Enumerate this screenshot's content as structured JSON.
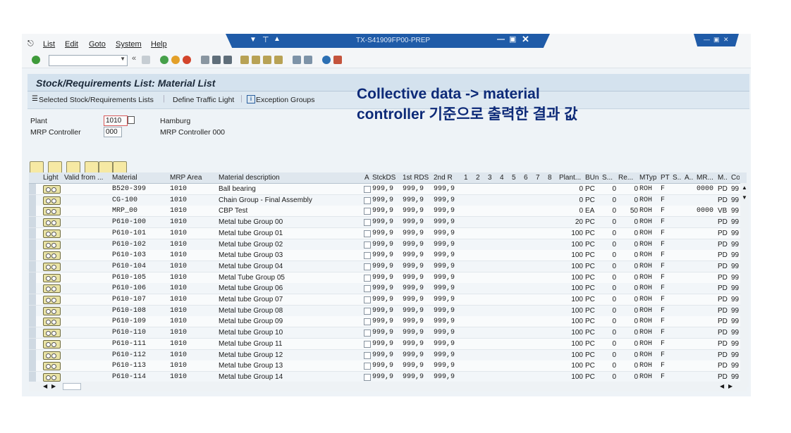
{
  "menu": [
    "List",
    "Edit",
    "Goto",
    "System",
    "Help"
  ],
  "window_title": "TX-S41909FP00-PREP",
  "page_title": "Stock/Requirements List: Material List",
  "app_toolbar": {
    "selected_lists": "Selected Stock/Requirements Lists",
    "define_traffic_light": "Define Traffic Light",
    "exception_groups": "Exception Groups"
  },
  "header": {
    "plant_label": "Plant",
    "plant_value": "1010",
    "plant_name": "Hamburg",
    "mrp_controller_label": "MRP Controller",
    "mrp_controller_value": "000",
    "mrp_controller_name": "MRP Controller 000"
  },
  "annotation": {
    "line1": "Collective data -> material",
    "line2": "controller 기준으로 출력한 결과 값"
  },
  "columns": [
    "Light",
    "Valid from ...",
    "Material",
    "MRP Area",
    "Material description",
    "A",
    "StckDS",
    "1st RDS",
    "2nd R",
    "1",
    "2",
    "3",
    "4",
    "5",
    "6",
    "7",
    "8",
    "Plant...",
    "BUn",
    "S...",
    "Re...",
    "MTyp",
    "PT",
    "S..",
    "A..",
    "MR...",
    "M..",
    "Co"
  ],
  "rows": [
    {
      "material": "B520-399",
      "area": "1010",
      "desc": "Ball bearing",
      "stckds": "999,9",
      "rds1": "999,9",
      "rds2": "999,9",
      "plant": "0",
      "bun": "PC",
      "s": "0",
      "re": "0",
      "mtyp": "ROH",
      "pt": "F",
      "mr": "0000",
      "m": "PD",
      "co": "99"
    },
    {
      "material": "CG-100",
      "area": "1010",
      "desc": "Chain Group - Final Assembly",
      "stckds": "999,9",
      "rds1": "999,9",
      "rds2": "999,9",
      "plant": "0",
      "bun": "PC",
      "s": "0",
      "re": "0",
      "mtyp": "ROH",
      "pt": "F",
      "mr": "",
      "m": "PD",
      "co": "99"
    },
    {
      "material": "MRP_00",
      "area": "1010",
      "desc": "CBP Test",
      "stckds": "999,9",
      "rds1": "999,9",
      "rds2": "999,9",
      "plant": "0",
      "bun": "EA",
      "s": "0",
      "re": "50",
      "mtyp": "ROH",
      "pt": "F",
      "mr": "0000",
      "m": "VB",
      "co": "99"
    },
    {
      "material": "P610-100",
      "area": "1010",
      "desc": "Metal tube Group 00",
      "stckds": "999,9",
      "rds1": "999,9",
      "rds2": "999,9",
      "plant": "20",
      "bun": "PC",
      "s": "0",
      "re": "0",
      "mtyp": "ROH",
      "pt": "F",
      "mr": "",
      "m": "PD",
      "co": "99"
    },
    {
      "material": "P610-101",
      "area": "1010",
      "desc": "Metal tube Group 01",
      "stckds": "999,9",
      "rds1": "999,9",
      "rds2": "999,9",
      "plant": "100",
      "bun": "PC",
      "s": "0",
      "re": "0",
      "mtyp": "ROH",
      "pt": "F",
      "mr": "",
      "m": "PD",
      "co": "99"
    },
    {
      "material": "P610-102",
      "area": "1010",
      "desc": "Metal tube Group 02",
      "stckds": "999,9",
      "rds1": "999,9",
      "rds2": "999,9",
      "plant": "100",
      "bun": "PC",
      "s": "0",
      "re": "0",
      "mtyp": "ROH",
      "pt": "F",
      "mr": "",
      "m": "PD",
      "co": "99"
    },
    {
      "material": "P610-103",
      "area": "1010",
      "desc": "Metal tube Group 03",
      "stckds": "999,9",
      "rds1": "999,9",
      "rds2": "999,9",
      "plant": "100",
      "bun": "PC",
      "s": "0",
      "re": "0",
      "mtyp": "ROH",
      "pt": "F",
      "mr": "",
      "m": "PD",
      "co": "99"
    },
    {
      "material": "P610-104",
      "area": "1010",
      "desc": "Metal tube Group 04",
      "stckds": "999,9",
      "rds1": "999,9",
      "rds2": "999,9",
      "plant": "100",
      "bun": "PC",
      "s": "0",
      "re": "0",
      "mtyp": "ROH",
      "pt": "F",
      "mr": "",
      "m": "PD",
      "co": "99"
    },
    {
      "material": "P610-105",
      "area": "1010",
      "desc": "Metal Tube Group 05",
      "stckds": "999,9",
      "rds1": "999,9",
      "rds2": "999,9",
      "plant": "100",
      "bun": "PC",
      "s": "0",
      "re": "0",
      "mtyp": "ROH",
      "pt": "F",
      "mr": "",
      "m": "PD",
      "co": "99"
    },
    {
      "material": "P610-106",
      "area": "1010",
      "desc": "Metal tube Group 06",
      "stckds": "999,9",
      "rds1": "999,9",
      "rds2": "999,9",
      "plant": "100",
      "bun": "PC",
      "s": "0",
      "re": "0",
      "mtyp": "ROH",
      "pt": "F",
      "mr": "",
      "m": "PD",
      "co": "99"
    },
    {
      "material": "P610-107",
      "area": "1010",
      "desc": "Metal tube Group 07",
      "stckds": "999,9",
      "rds1": "999,9",
      "rds2": "999,9",
      "plant": "100",
      "bun": "PC",
      "s": "0",
      "re": "0",
      "mtyp": "ROH",
      "pt": "F",
      "mr": "",
      "m": "PD",
      "co": "99"
    },
    {
      "material": "P610-108",
      "area": "1010",
      "desc": "Metal tube Group 08",
      "stckds": "999,9",
      "rds1": "999,9",
      "rds2": "999,9",
      "plant": "100",
      "bun": "PC",
      "s": "0",
      "re": "0",
      "mtyp": "ROH",
      "pt": "F",
      "mr": "",
      "m": "PD",
      "co": "99"
    },
    {
      "material": "P610-109",
      "area": "1010",
      "desc": "Metal tube Group 09",
      "stckds": "999,9",
      "rds1": "999,9",
      "rds2": "999,9",
      "plant": "100",
      "bun": "PC",
      "s": "0",
      "re": "0",
      "mtyp": "ROH",
      "pt": "F",
      "mr": "",
      "m": "PD",
      "co": "99"
    },
    {
      "material": "P610-110",
      "area": "1010",
      "desc": "Metal tube Group 10",
      "stckds": "999,9",
      "rds1": "999,9",
      "rds2": "999,9",
      "plant": "100",
      "bun": "PC",
      "s": "0",
      "re": "0",
      "mtyp": "ROH",
      "pt": "F",
      "mr": "",
      "m": "PD",
      "co": "99"
    },
    {
      "material": "P610-111",
      "area": "1010",
      "desc": "Metal tube Group 11",
      "stckds": "999,9",
      "rds1": "999,9",
      "rds2": "999,9",
      "plant": "100",
      "bun": "PC",
      "s": "0",
      "re": "0",
      "mtyp": "ROH",
      "pt": "F",
      "mr": "",
      "m": "PD",
      "co": "99"
    },
    {
      "material": "P610-112",
      "area": "1010",
      "desc": "Metal tube Group 12",
      "stckds": "999,9",
      "rds1": "999,9",
      "rds2": "999,9",
      "plant": "100",
      "bun": "PC",
      "s": "0",
      "re": "0",
      "mtyp": "ROH",
      "pt": "F",
      "mr": "",
      "m": "PD",
      "co": "99"
    },
    {
      "material": "P610-113",
      "area": "1010",
      "desc": "Metal tube Group 13",
      "stckds": "999,9",
      "rds1": "999,9",
      "rds2": "999,9",
      "plant": "100",
      "bun": "PC",
      "s": "0",
      "re": "0",
      "mtyp": "ROH",
      "pt": "F",
      "mr": "",
      "m": "PD",
      "co": "99"
    },
    {
      "material": "P610-114",
      "area": "1010",
      "desc": "Metal tube Group 14",
      "stckds": "999,9",
      "rds1": "999,9",
      "rds2": "999,9",
      "plant": "100",
      "bun": "PC",
      "s": "0",
      "re": "0",
      "mtyp": "ROH",
      "pt": "F",
      "mr": "",
      "m": "PD",
      "co": "99"
    }
  ],
  "colors": {
    "title_blue": "#1f5ba8",
    "annotation": "#0d2a78",
    "light_yellow": "#e9e3a6"
  }
}
